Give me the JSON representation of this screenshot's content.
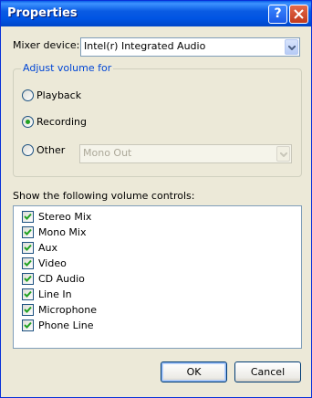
{
  "window": {
    "title": "Properties",
    "help_label": "?",
    "close_label": "×"
  },
  "mixer": {
    "label": "Mixer device:",
    "selected": "Intel(r) Integrated Audio"
  },
  "adjust_group": {
    "legend": "Adjust volume for",
    "options": [
      {
        "label": "Playback",
        "checked": false
      },
      {
        "label": "Recording",
        "checked": true
      },
      {
        "label": "Other",
        "checked": false
      }
    ],
    "other_combo": {
      "selected": "Mono Out",
      "enabled": false
    }
  },
  "controls": {
    "label": "Show the following volume controls:",
    "items": [
      {
        "label": "Stereo Mix",
        "checked": true
      },
      {
        "label": "Mono Mix",
        "checked": true
      },
      {
        "label": "Aux",
        "checked": true
      },
      {
        "label": "Video",
        "checked": true
      },
      {
        "label": "CD Audio",
        "checked": true
      },
      {
        "label": "Line In",
        "checked": true
      },
      {
        "label": "Microphone",
        "checked": true
      },
      {
        "label": "Phone Line",
        "checked": true
      }
    ]
  },
  "buttons": {
    "ok": "OK",
    "cancel": "Cancel"
  },
  "colors": {
    "titlebar": "#0054e3",
    "dialog_bg": "#ece9d8",
    "check_mark": "#21a121",
    "group_legend": "#0046d5"
  }
}
